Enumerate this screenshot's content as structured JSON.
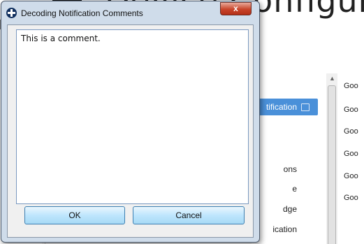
{
  "background": {
    "app_title": "Device Configur",
    "nav_items": [
      {
        "label": "tification",
        "selected": true,
        "has_note_icon": true
      },
      {
        "label": "ons",
        "selected": false
      },
      {
        "label": "e",
        "selected": false
      },
      {
        "label": "dge",
        "selected": false
      },
      {
        "label": "ication",
        "selected": false
      }
    ],
    "status_values": [
      "Goo",
      "Goo",
      "Goo",
      "Goo",
      "Goo",
      "Goo"
    ],
    "selection_color": "#4a90d9"
  },
  "dialog": {
    "title": "Decoding Notification Comments",
    "close_label": "x",
    "comment_value": "This is a comment.",
    "ok_label": "OK",
    "cancel_label": "Cancel",
    "accent_color": "#3c7fb1",
    "close_color": "#c8442a"
  }
}
